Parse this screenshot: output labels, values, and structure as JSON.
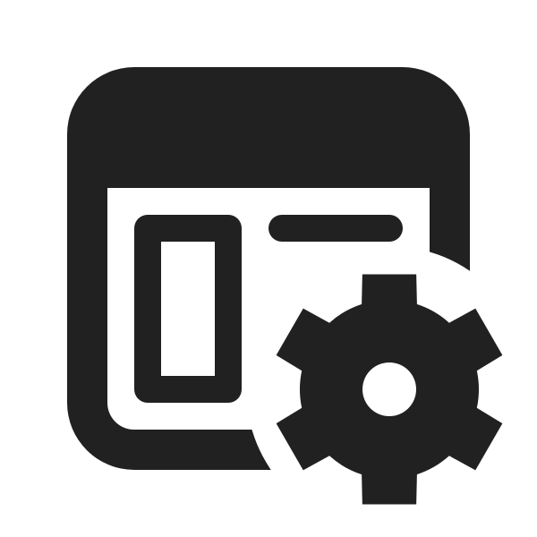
{
  "icon": {
    "name": "app-settings-icon",
    "color": "#212121",
    "background": "#ffffff",
    "parts": [
      "app-window-icon",
      "sidebar-panel-icon",
      "title-line-icon",
      "gear-icon"
    ]
  }
}
